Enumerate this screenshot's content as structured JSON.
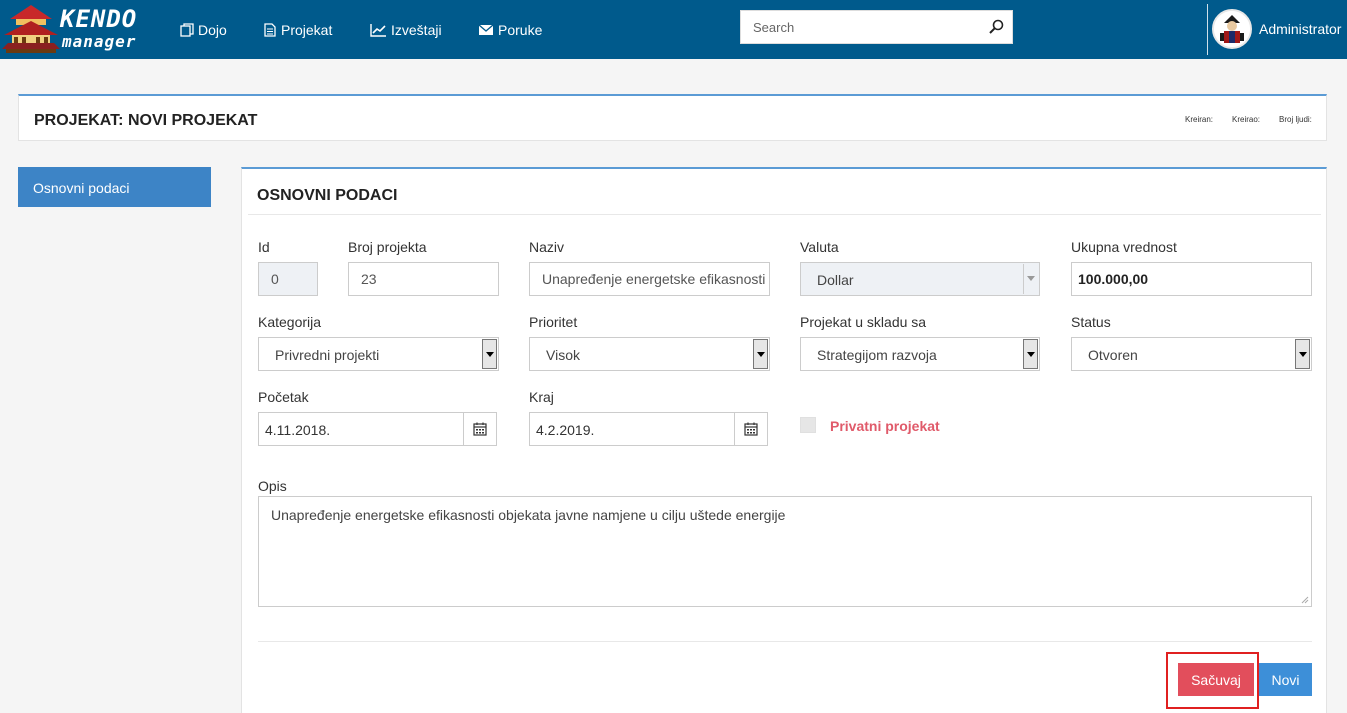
{
  "header": {
    "logo_text_1": "KENDO",
    "logo_text_2": "manager",
    "nav": [
      {
        "label": "Dojo",
        "icon": "copy-icon"
      },
      {
        "label": "Projekat",
        "icon": "document-icon"
      },
      {
        "label": "Izveštaji",
        "icon": "line-chart-icon"
      },
      {
        "label": "Poruke",
        "icon": "envelope-icon"
      }
    ],
    "search_placeholder": "Search",
    "user_name": "Administrator"
  },
  "title_panel": {
    "title": "PROJEKAT: NOVI PROJEKAT",
    "kreiran_label": "Kreiran:",
    "kreirao_label": "Kreirao:",
    "broj_ljudi_label": "Broj ljudi:"
  },
  "sidebar": {
    "items": [
      {
        "label": "Osnovni podaci"
      }
    ]
  },
  "form": {
    "heading": "OSNOVNI PODACI",
    "id": {
      "label": "Id",
      "value": "0"
    },
    "broj_projekta": {
      "label": "Broj projekta",
      "value": "23"
    },
    "naziv": {
      "label": "Naziv",
      "value": "Unapređenje energetske efikasnosti"
    },
    "valuta": {
      "label": "Valuta",
      "value": "Dollar"
    },
    "ukupna_vrednost": {
      "label": "Ukupna vrednost",
      "value": "100.000,00"
    },
    "kategorija": {
      "label": "Kategorija",
      "value": "Privredni projekti"
    },
    "prioritet": {
      "label": "Prioritet",
      "value": "Visok"
    },
    "u_skladu": {
      "label": "Projekat u skladu sa",
      "value": "Strategijom razvoja"
    },
    "status": {
      "label": "Status",
      "value": "Otvoren"
    },
    "pocetak": {
      "label": "Početak",
      "value": "4.11.2018."
    },
    "kraj": {
      "label": "Kraj",
      "value": "4.2.2019."
    },
    "privatni": {
      "label": "Privatni projekat",
      "checked": false
    },
    "opis": {
      "label": "Opis",
      "value": "Unapređenje energetske efikasnosti objekata javne namjene u cilju uštede energije"
    },
    "save_label": "Sačuvaj",
    "new_label": "Novi"
  },
  "colors": {
    "topbar": "#005a8c",
    "accent": "#3d84c6",
    "save": "#e24e5c",
    "new": "#3d8fd8",
    "checkbox_label": "#e05a6a"
  }
}
